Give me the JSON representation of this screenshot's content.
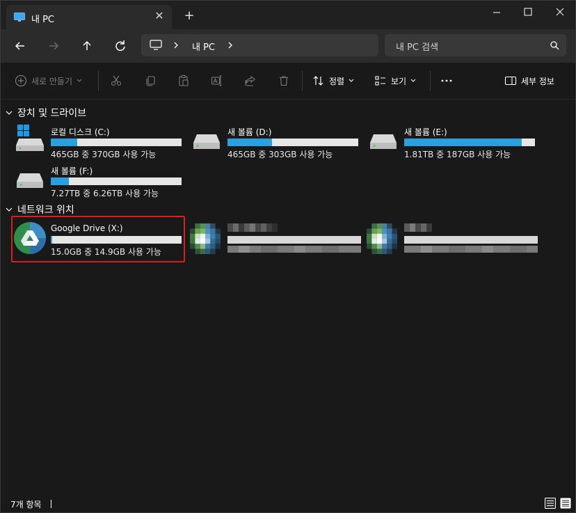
{
  "window": {
    "tab_title": "내 PC"
  },
  "address": {
    "location": "내 PC",
    "search_placeholder": "내 PC 검색"
  },
  "toolbar": {
    "new_label": "새로 만들기",
    "sort_label": "정렬",
    "view_label": "보기",
    "details_label": "세부 정보"
  },
  "groups": {
    "devices": {
      "title": "장치 및 드라이브",
      "drives": [
        {
          "name": "로컬 디스크 (C:)",
          "space": "465GB 중 370GB 사용 가능",
          "used_fraction": 0.2,
          "icon": "windows-drive-icon"
        },
        {
          "name": "새 볼륨 (D:)",
          "space": "465GB 중 303GB 사용 가능",
          "used_fraction": 0.34,
          "icon": "hard-drive-icon"
        },
        {
          "name": "새 볼륨 (E:)",
          "space": "1.81TB 중 187GB 사용 가능",
          "used_fraction": 0.9,
          "icon": "hard-drive-icon"
        },
        {
          "name": "새 볼륨 (F:)",
          "space": "7.27TB 중 6.26TB 사용 가능",
          "used_fraction": 0.14,
          "icon": "hard-drive-icon"
        }
      ]
    },
    "network": {
      "title": "네트워크 위치",
      "drives": [
        {
          "name": "Google Drive (X:)",
          "space": "15.0GB 중 14.9GB 사용 가능",
          "used_fraction": 0.01,
          "icon": "google-drive-icon"
        }
      ]
    }
  },
  "status": {
    "item_count": "7개 항목"
  },
  "colors": {
    "accent": "#2aa0de",
    "highlight": "#d81f1f",
    "background": "#191919"
  }
}
